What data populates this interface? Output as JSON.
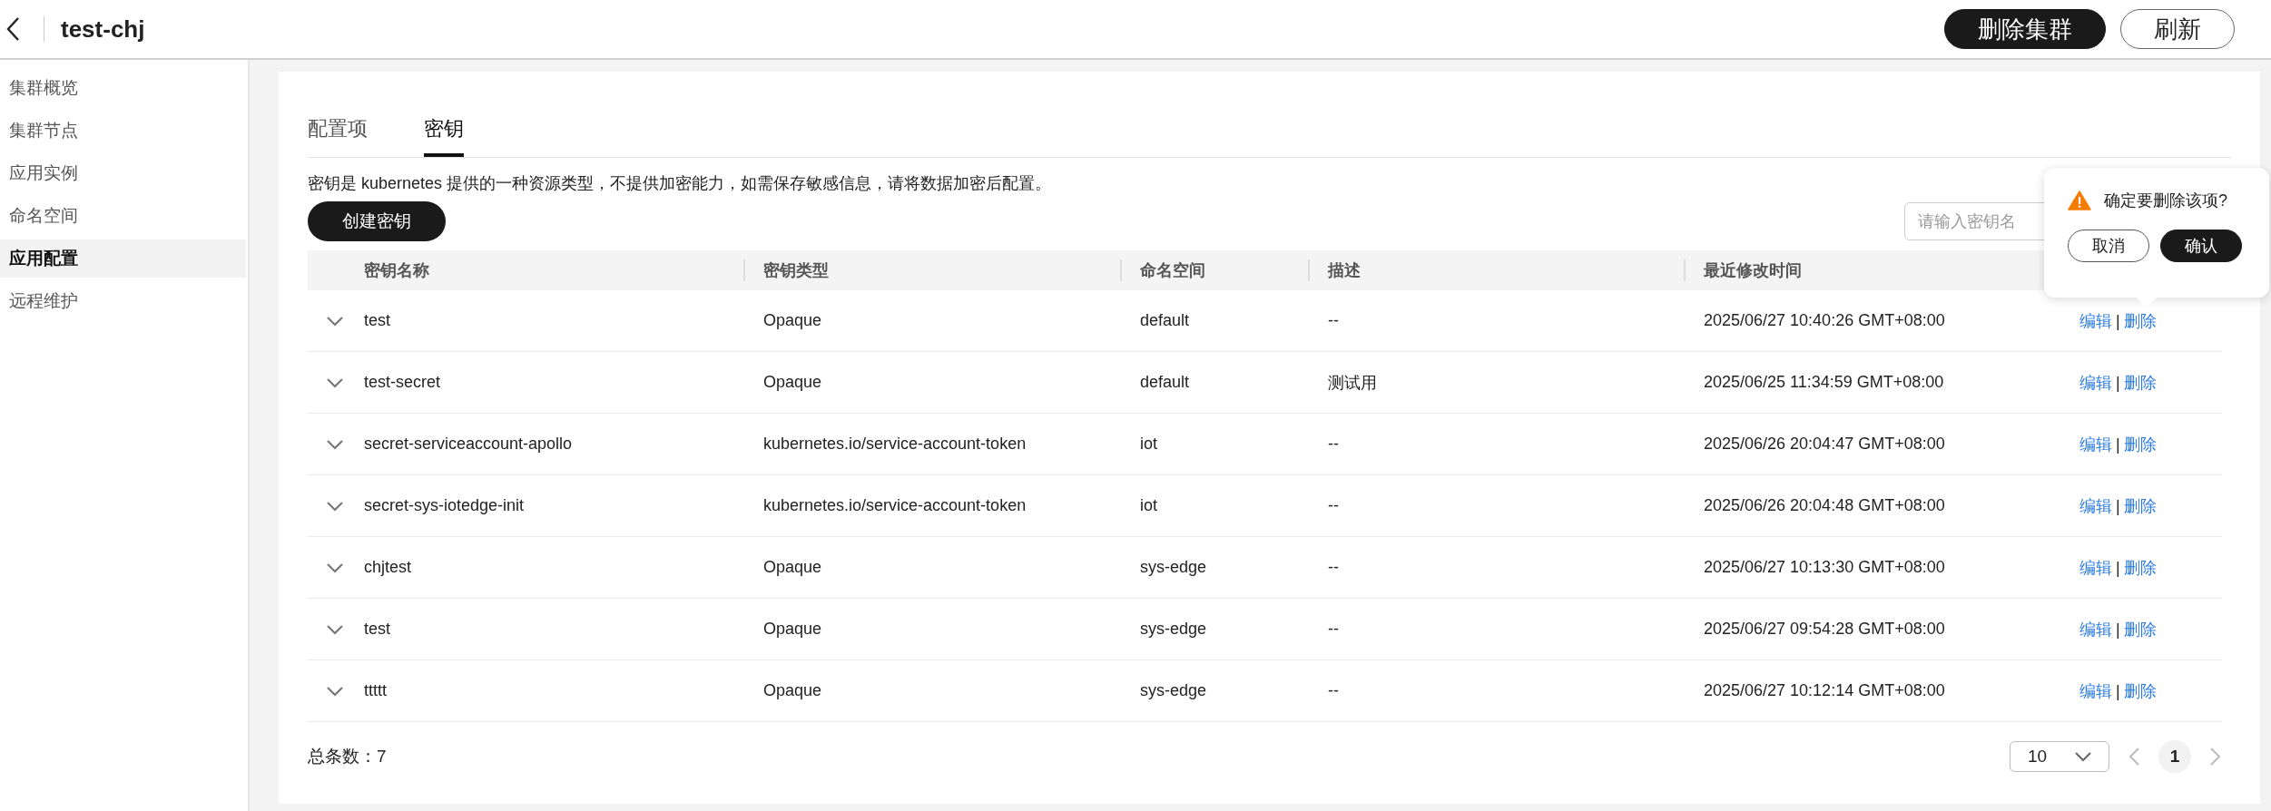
{
  "header": {
    "title": "test-chj",
    "buttons": [
      {
        "label": "删除集群",
        "kind": "primary"
      },
      {
        "label": "刷新",
        "kind": "outline"
      }
    ]
  },
  "sidebar": {
    "items": [
      {
        "label": "集群概览",
        "selected": false
      },
      {
        "label": "集群节点",
        "selected": false
      },
      {
        "label": "应用实例",
        "selected": false
      },
      {
        "label": "命名空间",
        "selected": false
      },
      {
        "label": "应用配置",
        "selected": true
      },
      {
        "label": "远程维护",
        "selected": false
      }
    ]
  },
  "tabs": [
    {
      "label": "配置项",
      "selected": false
    },
    {
      "label": "密钥",
      "selected": true
    }
  ],
  "description": "密钥是 kubernetes 提供的一种资源类型，不提供加密能力，如需保存敏感信息，请将数据加密后配置。",
  "create_button": "创建密钥",
  "search": {
    "placeholder": "请输入密钥名"
  },
  "table": {
    "columns": [
      "密钥名称",
      "密钥类型",
      "命名空间",
      "描述",
      "最近修改时间"
    ],
    "rows": [
      {
        "expanded": false,
        "cells": [
          "test",
          "Opaque",
          "default",
          "--",
          "2025/06/27 10:40:26 GMT+08:00"
        ],
        "actions": {
          "edit": "编辑",
          "separator": "|",
          "delete": "删除"
        }
      },
      {
        "expanded": false,
        "cells": [
          "test-secret",
          "Opaque",
          "default",
          "测试用",
          "2025/06/25 11:34:59 GMT+08:00"
        ],
        "actions": {
          "edit": "编辑",
          "separator": "|",
          "delete": "删除"
        }
      },
      {
        "expanded": false,
        "cells": [
          "secret-serviceaccount-apollo",
          "kubernetes.io/service-account-token",
          "iot",
          "--",
          "2025/06/26 20:04:47 GMT+08:00"
        ],
        "actions": {
          "edit": "编辑",
          "separator": "|",
          "delete": "删除"
        }
      },
      {
        "expanded": false,
        "cells": [
          "secret-sys-iotedge-init",
          "kubernetes.io/service-account-token",
          "iot",
          "--",
          "2025/06/26 20:04:48 GMT+08:00"
        ],
        "actions": {
          "edit": "编辑",
          "separator": "|",
          "delete": "删除"
        }
      },
      {
        "expanded": false,
        "cells": [
          "chjtest",
          "Opaque",
          "sys-edge",
          "--",
          "2025/06/27 10:13:30 GMT+08:00"
        ],
        "actions": {
          "edit": "编辑",
          "separator": "|",
          "delete": "删除"
        }
      },
      {
        "expanded": false,
        "cells": [
          "test",
          "Opaque",
          "sys-edge",
          "--",
          "2025/06/27 09:54:28 GMT+08:00"
        ],
        "actions": {
          "edit": "编辑",
          "separator": "|",
          "delete": "删除"
        }
      },
      {
        "expanded": false,
        "cells": [
          "ttttt",
          "Opaque",
          "sys-edge",
          "--",
          "2025/06/27 10:12:14 GMT+08:00"
        ],
        "actions": {
          "edit": "编辑",
          "separator": "|",
          "delete": "删除"
        }
      }
    ]
  },
  "popconfirm": {
    "message": "确定要删除该项?",
    "cancel": "取消",
    "confirm": "确认"
  },
  "footer": {
    "total": "总条数：7",
    "page_size": "10",
    "pages": [
      {
        "label": "1",
        "selected": true
      }
    ],
    "prev_disabled": true,
    "next_disabled": true
  }
}
